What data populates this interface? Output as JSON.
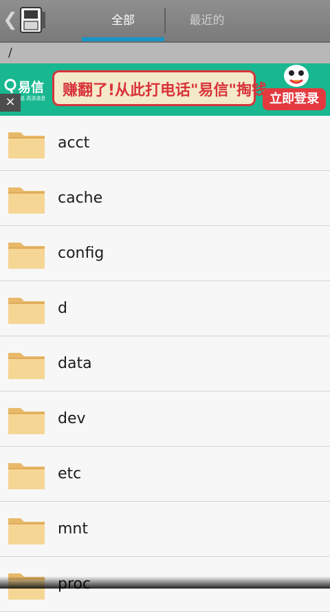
{
  "header": {
    "tabs": [
      {
        "label": "全部",
        "selected": true
      },
      {
        "label": "最近的",
        "selected": false
      }
    ]
  },
  "path": {
    "current": "/"
  },
  "ad": {
    "brand": "易信",
    "brand_sub": "免费电话 高清语音",
    "slogan": "赚翻了!从此打电话\"易信\"掏钱",
    "cta": "立即登录",
    "close": "×"
  },
  "files": [
    {
      "name": "acct",
      "type": "folder"
    },
    {
      "name": "cache",
      "type": "folder"
    },
    {
      "name": "config",
      "type": "folder"
    },
    {
      "name": "d",
      "type": "folder"
    },
    {
      "name": "data",
      "type": "folder"
    },
    {
      "name": "dev",
      "type": "folder"
    },
    {
      "name": "etc",
      "type": "folder"
    },
    {
      "name": "mnt",
      "type": "folder"
    },
    {
      "name": "proc",
      "type": "folder"
    }
  ],
  "colors": {
    "accent": "#1996c8",
    "ad_bg": "#19b790",
    "ad_red": "#d8343a"
  }
}
